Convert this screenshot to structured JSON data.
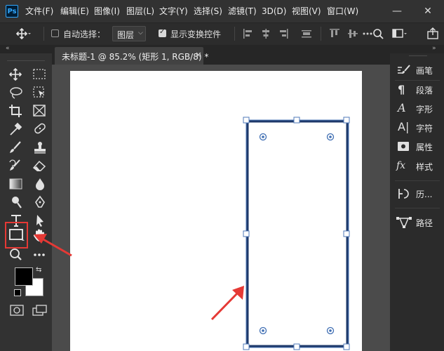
{
  "app": {
    "logo_text": "Ps"
  },
  "menu": [
    "文件(F)",
    "编辑(E)",
    "图像(I)",
    "图层(L)",
    "文字(Y)",
    "选择(S)",
    "滤镜(T)",
    "3D(D)",
    "视图(V)",
    "窗口(W)"
  ],
  "window_controls": {
    "minimize": "—",
    "close": "✕"
  },
  "options": {
    "auto_select_label": "自动选择：",
    "auto_select_checked": false,
    "layer_select_value": "图层",
    "show_transform_label": "显示变换控件",
    "show_transform_checked": true
  },
  "document_tab": {
    "title": "未标题-1 @ 85.2% (矩形 1, RGB/8) *",
    "close": "×"
  },
  "panels": [
    {
      "label": "画笔",
      "icon": "brush-panel-icon"
    },
    {
      "label": "段落",
      "icon": "paragraph-icon"
    },
    {
      "label": "字形",
      "icon": "glyphs-icon"
    },
    {
      "label": "字符",
      "icon": "character-icon"
    },
    {
      "label": "属性",
      "icon": "properties-icon"
    },
    {
      "label": "样式",
      "icon": "styles-icon"
    },
    {
      "label": "历...",
      "icon": "history-icon"
    },
    {
      "label": "路径",
      "icon": "paths-icon"
    }
  ],
  "colors": {
    "accent_highlight": "#e53935",
    "selection_stroke": "#1f3a6b",
    "foreground_color": "#000000",
    "background_color": "#ffffff"
  }
}
